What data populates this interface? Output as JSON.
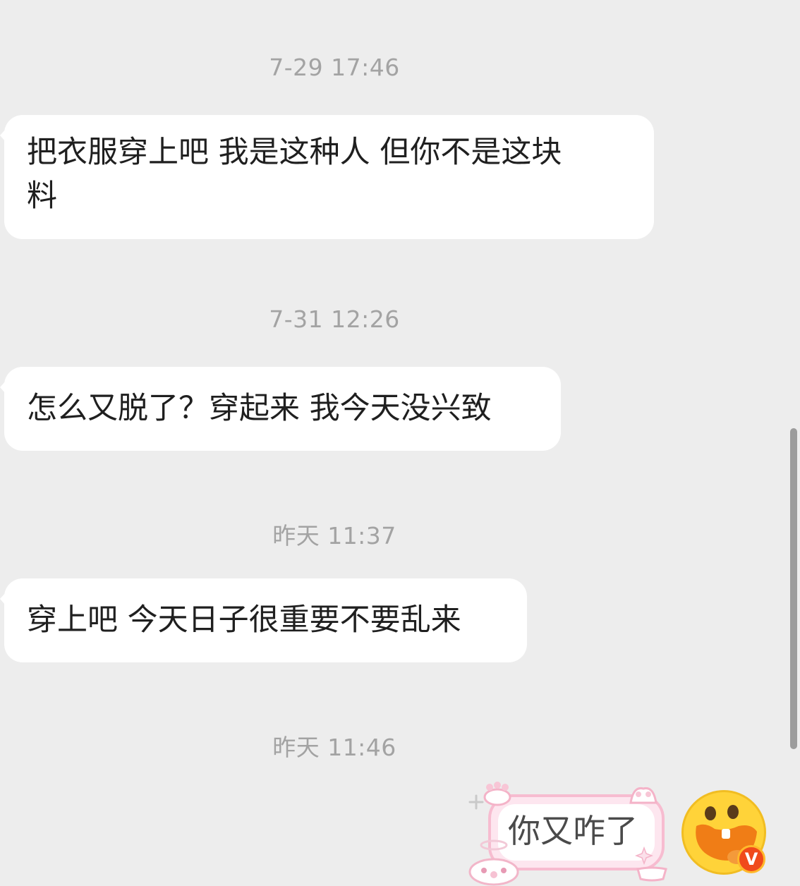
{
  "chat": {
    "messages": [
      {
        "timestamp": "7-29 17:46",
        "text_line1": "把衣服穿上吧 我是这种人 但你不是这块",
        "text_line2": "料"
      },
      {
        "timestamp": "7-31 12:26",
        "text": "怎么又脱了？穿起来 我今天没兴致"
      },
      {
        "timestamp": "昨天 11:37",
        "text": "穿上吧 今天日子很重要不要乱来"
      },
      {
        "timestamp": "昨天 11:46",
        "text": "你又咋了"
      }
    ]
  },
  "icons": {
    "avatar": "smiley-tongue-avatar-icon",
    "badge": "verified-v-badge-icon",
    "scrollbar": "scrollbar"
  },
  "colors": {
    "background": "#ededed",
    "bubble": "#ffffff",
    "timestamp": "#a3a3a3",
    "my_bubble_border": "#f7bcd0",
    "avatar": "#ffd339",
    "badge": "#f04a1b"
  },
  "badge_letter": "V"
}
